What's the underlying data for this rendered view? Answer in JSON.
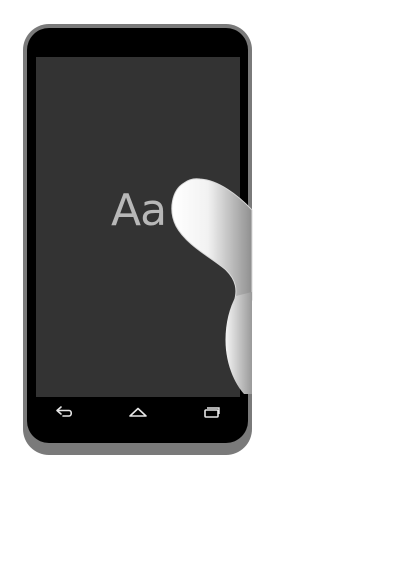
{
  "device": {
    "screen_color": "#333333",
    "frame_color": "#7a7a7a",
    "body_color": "#000000"
  },
  "screen": {
    "preview_text": "Aa",
    "preview_text_color": "#b8b8b8"
  },
  "navigation": {
    "back_icon": "back-icon",
    "home_icon": "home-icon",
    "recents_icon": "recents-icon",
    "icon_color": "#e6e6e6"
  },
  "gesture": {
    "hand_icon": "thumb-swipe-icon"
  }
}
